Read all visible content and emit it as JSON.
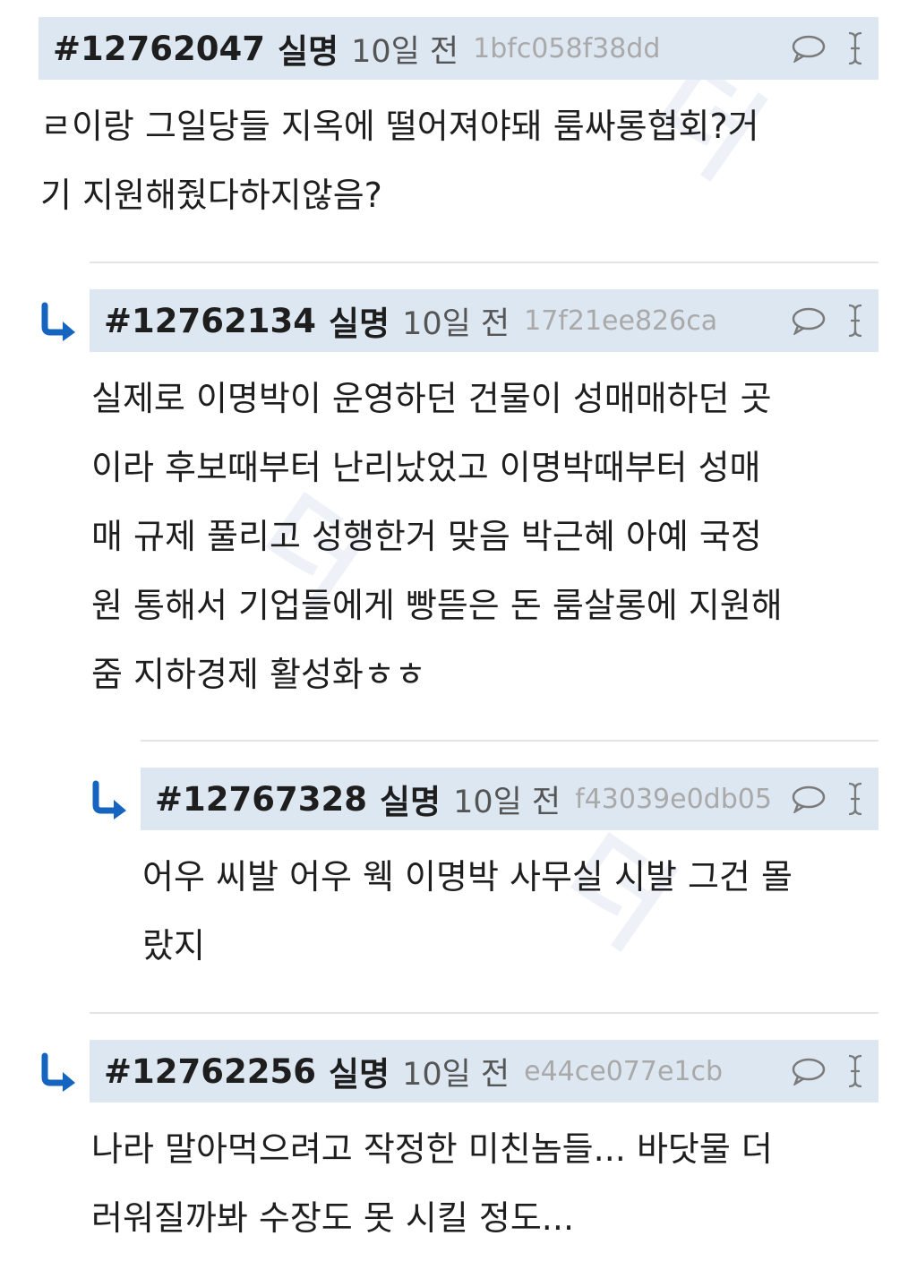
{
  "comments": [
    {
      "number": "#12762047",
      "name": "실명",
      "time": "10일 전",
      "hash": "1bfc058f38dd",
      "lines": [
        "ㄹ이랑 그일당들 지옥에 떨어져야돼 룸싸롱협회?거",
        "기 지원해줬다하지않음?"
      ]
    },
    {
      "number": "#12762134",
      "name": "실명",
      "time": "10일 전",
      "hash": "17f21ee826ca",
      "lines": [
        "실제로 이명박이 운영하던 건물이 성매매하던 곳",
        "이라 후보때부터 난리났었고 이명박때부터 성매",
        "매 규제 풀리고 성행한거 맞음 박근혜 아예 국정",
        "원 통해서 기업들에게 빵뜯은 돈 룸살롱에 지원해",
        "줌 지하경제 활성화ㅎㅎ"
      ]
    },
    {
      "number": "#12767328",
      "name": "실명",
      "time": "10일 전",
      "hash": "f43039e0db05",
      "lines": [
        "어우 씨발 어우 웩 이명박 사무실 시발 그건 몰",
        "랐지"
      ]
    },
    {
      "number": "#12762256",
      "name": "실명",
      "time": "10일 전",
      "hash": "e44ce077e1cb",
      "lines": [
        "나라 말아먹으려고 작정한 미친놈들... 바닷물 더",
        "러워질까봐 수장도 못 시킬 정도..."
      ]
    }
  ],
  "icons": {
    "reply": "comment-bubble-icon",
    "select": "text-cursor-icon",
    "indent": "reply-arrow-icon"
  },
  "colors": {
    "header_bg": "#dde7f1",
    "arrow": "#1565c0",
    "hash": "#a9a9a9"
  }
}
